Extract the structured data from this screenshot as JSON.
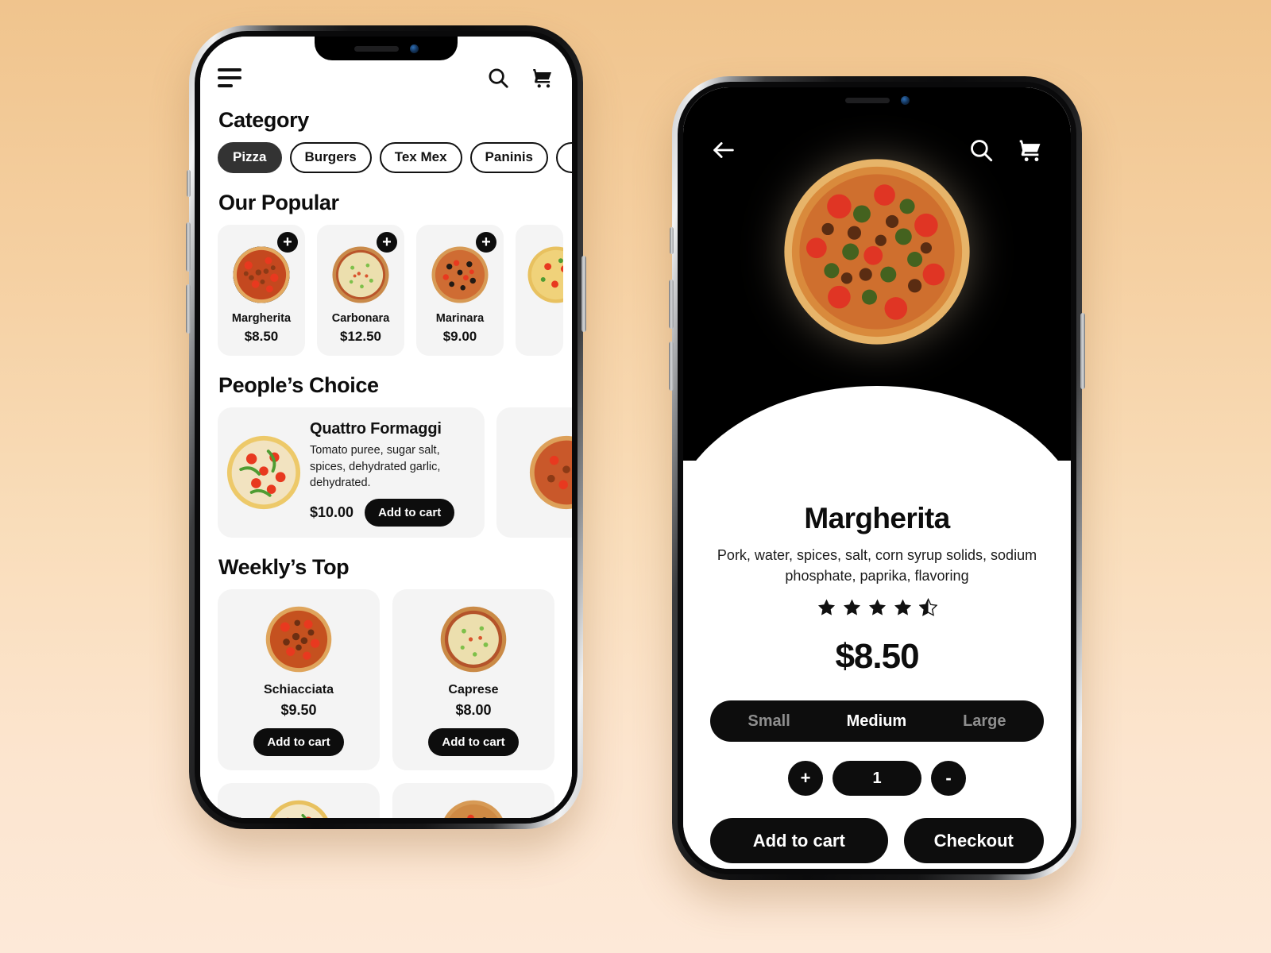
{
  "background": {
    "top_color": "#f0c48d",
    "bottom_color": "#fde9d8"
  },
  "menu_phone": {
    "topbar": {
      "menu_icon": "hamburger-icon",
      "search_icon": "search-icon",
      "cart_icon": "shopping-cart-icon"
    },
    "category": {
      "title": "Category",
      "pills": [
        {
          "label": "Pizza",
          "active": true
        },
        {
          "label": "Burgers",
          "active": false
        },
        {
          "label": "Tex Mex",
          "active": false
        },
        {
          "label": "Paninis",
          "active": false
        }
      ]
    },
    "popular": {
      "title": "Our Popular",
      "add_icon": "plus-icon",
      "items": [
        {
          "name": "Margherita",
          "price": "$8.50"
        },
        {
          "name": "Carbonara",
          "price": "$12.50"
        },
        {
          "name": "Marinara",
          "price": "$9.00"
        }
      ]
    },
    "peoples_choice": {
      "title": "People’s Choice",
      "item": {
        "name": "Quattro Formaggi",
        "description": "Tomato puree, sugar salt, spices, dehydrated garlic, dehydrated.",
        "price": "$10.00",
        "button": "Add to cart"
      }
    },
    "weekly_top": {
      "title": "Weekly’s Top",
      "items": [
        {
          "name": "Schiacciata",
          "price": "$9.50",
          "button": "Add to cart"
        },
        {
          "name": "Caprese",
          "price": "$8.00",
          "button": "Add to cart"
        }
      ]
    }
  },
  "detail_phone": {
    "topbar": {
      "back_icon": "back-arrow-icon",
      "search_icon": "search-icon",
      "cart_icon": "shopping-cart-icon"
    },
    "product": {
      "name": "Margherita",
      "description": "Pork, water, spices, salt, corn syrup solids, sodium phosphate, paprika, flavoring",
      "rating": 4.5,
      "rating_max": 5,
      "price": "$8.50"
    },
    "sizes": [
      {
        "label": "Small",
        "selected": false
      },
      {
        "label": "Medium",
        "selected": true
      },
      {
        "label": "Large",
        "selected": false
      }
    ],
    "quantity": {
      "increase": "+",
      "value": "1",
      "decrease": "-"
    },
    "actions": [
      {
        "label": "Add to cart"
      },
      {
        "label": "Checkout"
      }
    ]
  }
}
